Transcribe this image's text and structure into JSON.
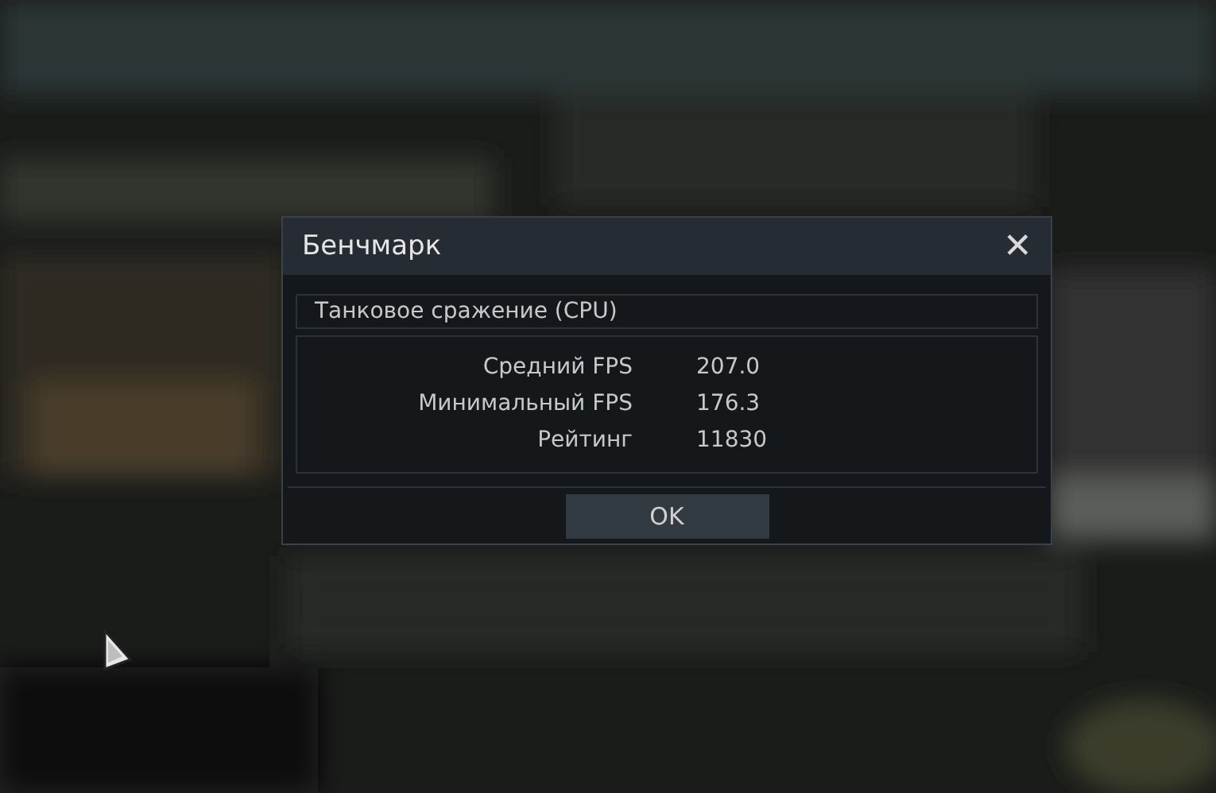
{
  "dialog": {
    "title": "Бенчмарк",
    "close": "✕",
    "test_name": "Танковое сражение (CPU)",
    "results": [
      {
        "label": "Средний FPS",
        "value": "207.0"
      },
      {
        "label": "Минимальный FPS",
        "value": "176.3"
      },
      {
        "label": "Рейтинг",
        "value": "11830"
      }
    ],
    "button": "OK"
  }
}
